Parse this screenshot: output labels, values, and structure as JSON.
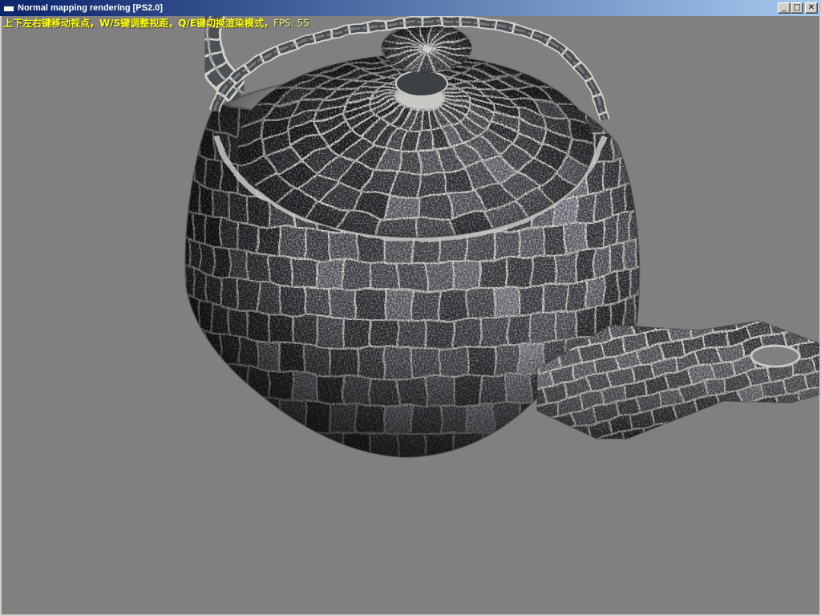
{
  "window": {
    "title": "Normal mapping rendering [PS2.0]",
    "colors": {
      "title_bar_start": "#0a246a",
      "title_bar_end": "#a6caf0",
      "title_text": "#ffffff",
      "frame": "#d4d0c8",
      "viewport_background": "#808080",
      "hud_text": "#ffff00"
    }
  },
  "title_bar": {
    "icon": "application-window-icon",
    "buttons": {
      "minimize": "_",
      "maximize": "□",
      "close": "✕"
    }
  },
  "hud": {
    "hint": "上下左右键移动视点，W/S键调整视距，Q/E键切换渲染模式，",
    "fps_label": "FPS: ",
    "fps_value": "55"
  }
}
